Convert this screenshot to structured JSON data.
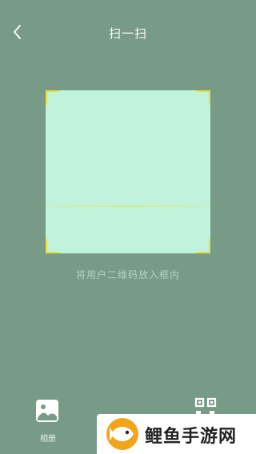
{
  "header": {
    "title": "扫一扫",
    "back_icon": "chevron-left-icon"
  },
  "scanner": {
    "hint": "将用户二维码放入框内",
    "frame_color": "#c1f3dc",
    "corner_color": "#e8df3a"
  },
  "bottom_bar": {
    "album_label": "相册",
    "album_icon": "image-icon",
    "qr_icon": "qr-code-icon"
  },
  "watermark": {
    "text": "鲤鱼手游网"
  },
  "colors": {
    "background": "#789b88"
  }
}
